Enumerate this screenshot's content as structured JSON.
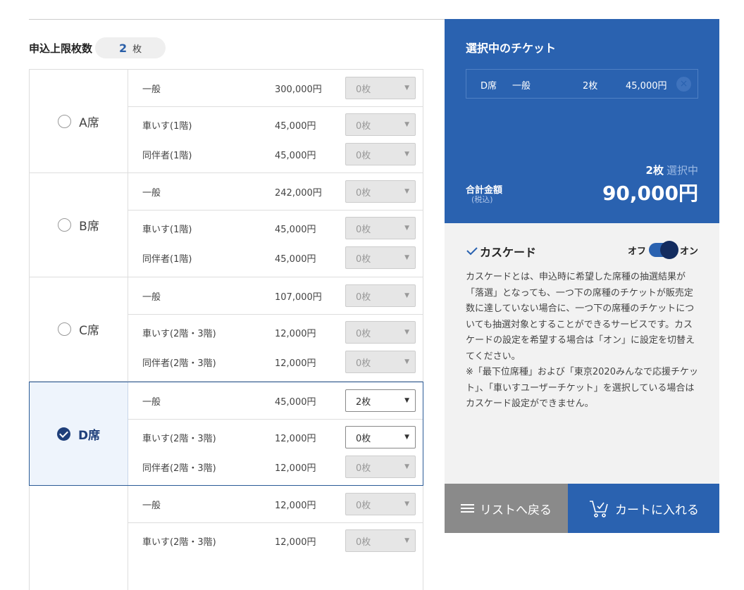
{
  "limit": {
    "label": "申込上限枚数",
    "value": "2",
    "unit": "枚"
  },
  "seats": [
    {
      "name": "A席",
      "selected": false,
      "rows": [
        {
          "type": "一般",
          "price": "300,000円",
          "qty": "0枚",
          "active": false
        },
        {
          "type": "車いす(1階)",
          "price": "45,000円",
          "qty": "0枚",
          "active": false
        },
        {
          "type": "同伴者(1階)",
          "price": "45,000円",
          "qty": "0枚",
          "active": false
        }
      ]
    },
    {
      "name": "B席",
      "selected": false,
      "rows": [
        {
          "type": "一般",
          "price": "242,000円",
          "qty": "0枚",
          "active": false
        },
        {
          "type": "車いす(1階)",
          "price": "45,000円",
          "qty": "0枚",
          "active": false
        },
        {
          "type": "同伴者(1階)",
          "price": "45,000円",
          "qty": "0枚",
          "active": false
        }
      ]
    },
    {
      "name": "C席",
      "selected": false,
      "rows": [
        {
          "type": "一般",
          "price": "107,000円",
          "qty": "0枚",
          "active": false
        },
        {
          "type": "車いす(2階・3階)",
          "price": "12,000円",
          "qty": "0枚",
          "active": false
        },
        {
          "type": "同伴者(2階・3階)",
          "price": "12,000円",
          "qty": "0枚",
          "active": false
        }
      ]
    },
    {
      "name": "D席",
      "selected": true,
      "rows": [
        {
          "type": "一般",
          "price": "45,000円",
          "qty": "2枚",
          "active": true
        },
        {
          "type": "車いす(2階・3階)",
          "price": "12,000円",
          "qty": "0枚",
          "active": true
        },
        {
          "type": "同伴者(2階・3階)",
          "price": "12,000円",
          "qty": "0枚",
          "active": false
        }
      ]
    },
    {
      "name": "",
      "selected": false,
      "rows": [
        {
          "type": "一般",
          "price": "12,000円",
          "qty": "0枚",
          "active": false
        },
        {
          "type": "車いす(2階・3階)",
          "price": "12,000円",
          "qty": "0枚",
          "active": false
        }
      ]
    }
  ],
  "selected_panel": {
    "title": "選択中のチケット",
    "ticket": {
      "seat": "D席",
      "type": "一般",
      "count": "2枚",
      "price": "45,000円"
    },
    "count_value": "2枚",
    "count_suffix": "選択中",
    "total_label": "合計金額",
    "total_sub": "(税込)",
    "total_amount": "90,000円"
  },
  "cascade": {
    "title": "カスケード",
    "off_label": "オフ",
    "on_label": "オン",
    "enabled": true,
    "desc1": "カスケードとは、申込時に希望した席種の抽選結果が「落選」となっても、一つ下の席種のチケットが販売定数に達していない場合に、一つ下の席種のチケットについても抽選対象とすることができるサービスです。カスケードの設定を希望する場合は「オン」に設定を切替えてください。",
    "desc2": "※「最下位席種」および「東京2020みんなで応援チケット」、「車いすユーザーチケット」を選択している場合はカスケード設定ができません。"
  },
  "buttons": {
    "back": "リストへ戻る",
    "cart": "カートに入れる"
  },
  "colors": {
    "brand": "#2a62b0",
    "dark_brand": "#132c5f",
    "back_button": "#8a8a8a"
  }
}
